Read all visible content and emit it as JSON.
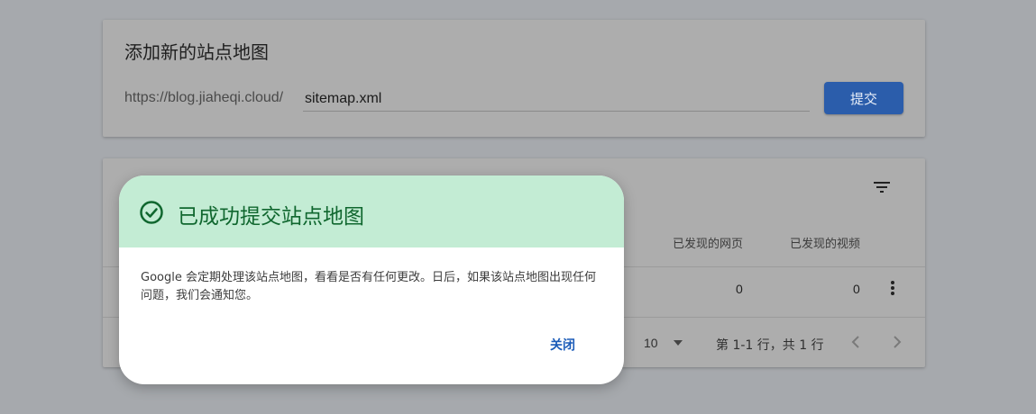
{
  "add_sitemap": {
    "title": "添加新的站点地图",
    "url_prefix": "https://blog.jiaheqi.cloud/",
    "input_value": "sitemap.xml",
    "submit_label": "提交",
    "accent_color": "#2b5dab"
  },
  "sitemap_list": {
    "columns": [
      "已发现的网页",
      "已发现的视频"
    ],
    "rows": [
      {
        "pages": "0",
        "videos": "0"
      }
    ],
    "pagination": {
      "page_size": "10",
      "range": "第 1-1 行，共 1 行"
    }
  },
  "dialog": {
    "title": "已成功提交站点地图",
    "message": "Google 会定期处理该站点地图，看看是否有任何更改。日后，如果该站点地图出现任何问题，我们会通知您。",
    "close_label": "关闭",
    "header_color": "#c3ecd4",
    "title_color": "#10672f"
  }
}
